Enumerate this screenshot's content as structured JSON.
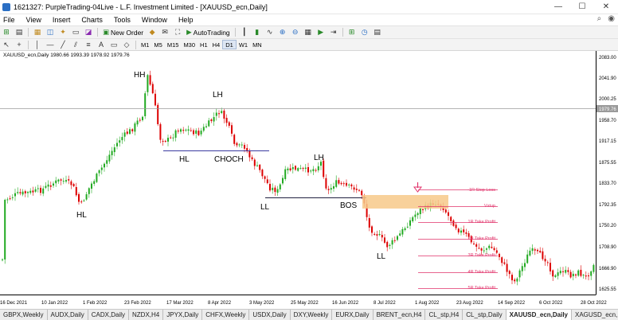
{
  "window": {
    "title": "1621327: PurpleTrading-04Live - L.F. Investment Limited - [XAUUSD_ecn,Daily]",
    "controls": [
      "—",
      "☐",
      "✕"
    ]
  },
  "menu": [
    "File",
    "View",
    "Insert",
    "Charts",
    "Tools",
    "Window",
    "Help"
  ],
  "toolbar": {
    "new_order": "New Order",
    "autotrading": "AutoTrading",
    "timeframes": [
      "M1",
      "M5",
      "M15",
      "M30",
      "H1",
      "H4",
      "D1",
      "W1",
      "MN"
    ],
    "selected_timeframe": "D1"
  },
  "chart": {
    "info": "XAUUSD_ecn,Daily  1980.66 1993.39 1978.92 1979.76",
    "current_price": "1979.76",
    "price_labels": [
      "2083.00",
      "2041.90",
      "2000.25",
      "1958.70",
      "1917.15",
      "1875.55",
      "1833.70",
      "1792.35",
      "1750.20",
      "1708.90",
      "1666.90",
      "1625.55"
    ],
    "date_labels": [
      "16 Dec 2021",
      "10 Jan 2022",
      "1 Feb 2022",
      "23 Feb 2022",
      "17 Mar 2022",
      "8 Apr 2022",
      "3 May 2022",
      "25 May 2022",
      "16 Jun 2022",
      "8 Jul 2022",
      "1 Aug 2022",
      "23 Aug 2022",
      "14 Sep 2022",
      "6 Oct 2022",
      "28 Oct 2022"
    ],
    "annotations": {
      "hh": "HH",
      "lh1": "LH",
      "hl1": "HL",
      "hl2": "HL",
      "choch": "CHOCH",
      "lh2": "LH",
      "ll1": "LL",
      "bos": "BOS",
      "ll2": "LL"
    },
    "levels": [
      "-1R Stop Loss",
      "Vstup",
      "1R Take Profit",
      "2R Take Profit",
      "3R Take Profit",
      "4R Take Profit",
      "5R Take Profit"
    ],
    "colors": {
      "bull": "#22aa22",
      "bear": "#dd0000",
      "zone": "#f7c98a",
      "levels": "#e0326a",
      "lines": "#3a3aa0"
    }
  },
  "tabs": [
    "GBPX,Weekly",
    "AUDX,Daily",
    "CADX,Daily",
    "NZDX,H4",
    "JPYX,Daily",
    "CHFX,Weekly",
    "USDX,Daily",
    "DXY,Weekly",
    "EURX,Daily",
    "BRENT_ecn,H4",
    "CL_stp,H4",
    "CL_stp,Daily",
    "XAUUSD_ecn,Daily",
    "XAGUSD_ecn,Daily"
  ],
  "active_tab": "XAUUSD_ecn,Daily"
}
